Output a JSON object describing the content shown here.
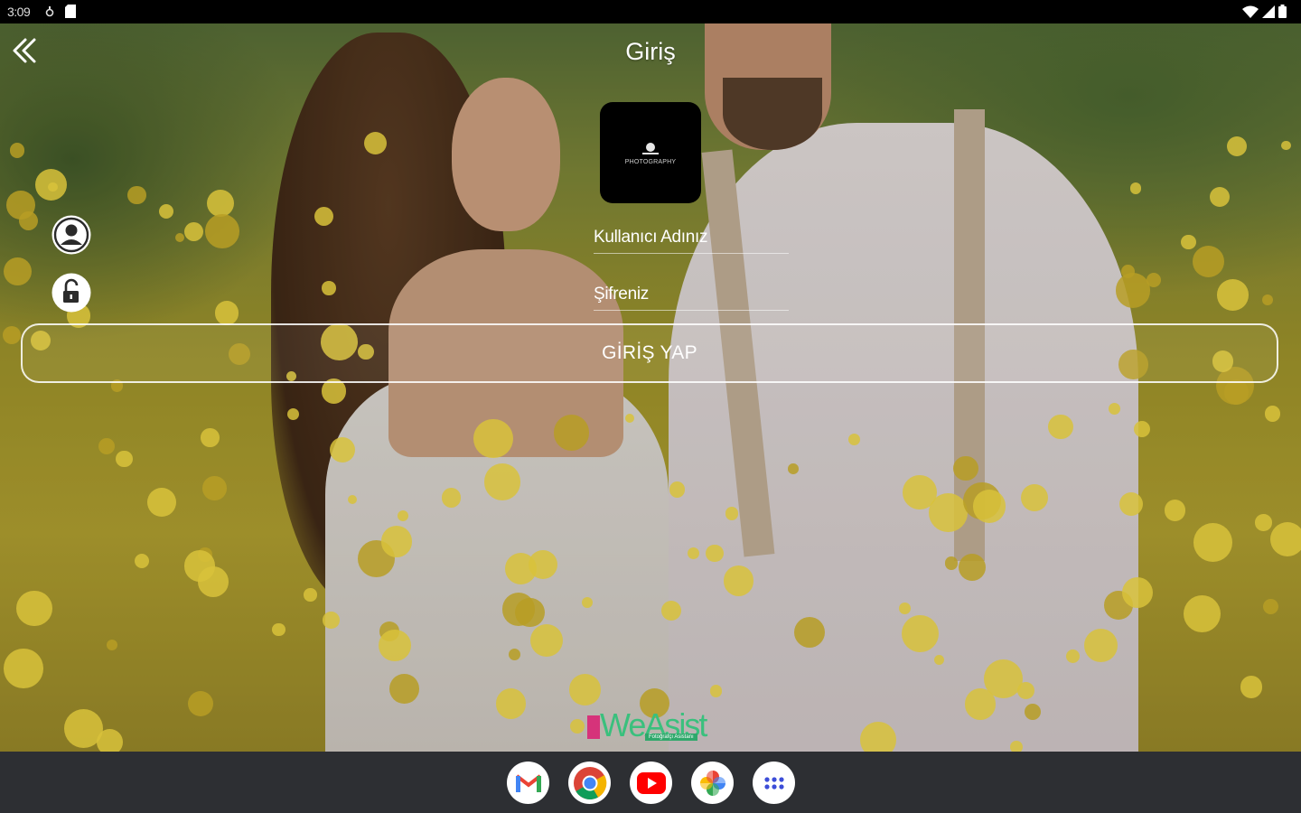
{
  "status_bar": {
    "time": "3:09"
  },
  "header": {
    "title": "Giriş"
  },
  "logo": {
    "text": "PHOTOGRAPHY"
  },
  "form": {
    "username_placeholder": "Kullanıcı Adınız",
    "username_value": "",
    "password_placeholder": "Şifreniz",
    "password_value": "",
    "submit_label": "GİRİŞ YAP"
  },
  "brand": {
    "name": "WeAsist",
    "tagline": "Fotoğrafçı Asistanı"
  },
  "dock": {
    "apps": [
      {
        "name": "Gmail",
        "icon": "gmail-icon"
      },
      {
        "name": "Chrome",
        "icon": "chrome-icon"
      },
      {
        "name": "YouTube",
        "icon": "youtube-icon"
      },
      {
        "name": "Photos",
        "icon": "photos-icon"
      },
      {
        "name": "App drawer",
        "icon": "app-drawer-icon"
      }
    ]
  },
  "colors": {
    "accent_brand": "#3ac07d",
    "taskbar": "#2d2f33"
  }
}
